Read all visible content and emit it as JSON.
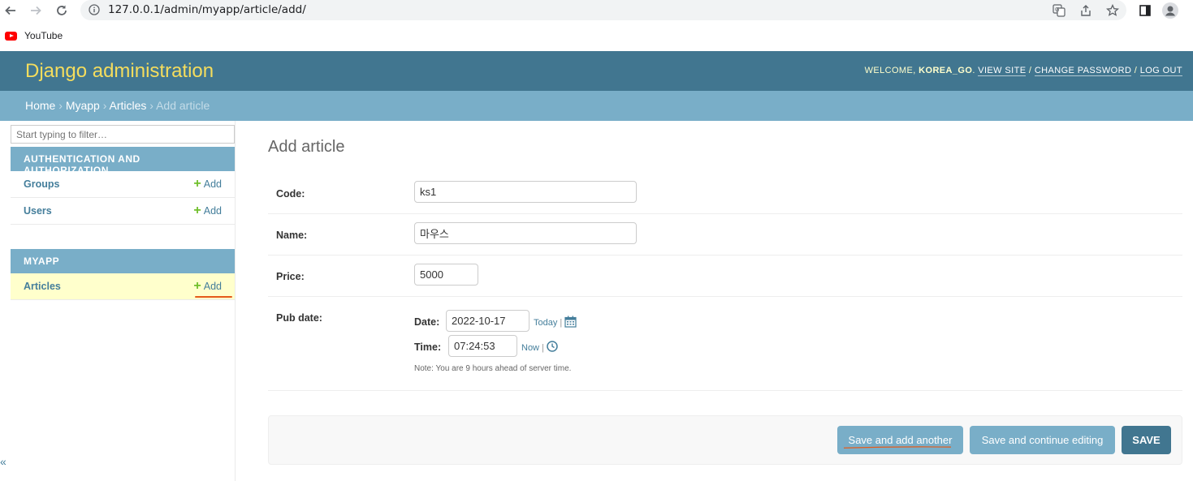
{
  "browser": {
    "url": "127.0.0.1/admin/myapp/article/add/",
    "bookmarks": [
      {
        "label": "YouTube"
      }
    ]
  },
  "header": {
    "site_title": "Django administration",
    "welcome_prefix": "WELCOME, ",
    "username": "KOREA_GO",
    "welcome_suffix": ". ",
    "view_site": "VIEW SITE",
    "sep1": " / ",
    "change_password": "CHANGE PASSWORD",
    "sep2": " / ",
    "logout": "LOG OUT"
  },
  "breadcrumbs": {
    "home": "Home",
    "sep": " › ",
    "app": "Myapp",
    "model": "Articles",
    "current": "Add article"
  },
  "sidebar": {
    "filter_placeholder": "Start typing to filter…",
    "modules": [
      {
        "caption": "AUTHENTICATION AND AUTHORIZATION",
        "models": [
          {
            "name": "Groups",
            "add_label": "Add"
          },
          {
            "name": "Users",
            "add_label": "Add"
          }
        ]
      },
      {
        "caption": "MYAPP",
        "models": [
          {
            "name": "Articles",
            "add_label": "Add",
            "current": true
          }
        ]
      }
    ],
    "collapse_glyph": "«"
  },
  "form": {
    "title": "Add article",
    "fields": {
      "code": {
        "label": "Code:",
        "value": "ks1"
      },
      "name": {
        "label": "Name:",
        "value": "마우스"
      },
      "price": {
        "label": "Price:",
        "value": "5000"
      },
      "pub_date": {
        "label": "Pub date:",
        "date_label": "Date:",
        "date_value": "2022-10-17",
        "today_label": "Today",
        "time_label": "Time:",
        "time_value": "07:24:53",
        "now_label": "Now",
        "sep": "|",
        "note": "Note: You are 9 hours ahead of server time."
      }
    },
    "buttons": {
      "save_add_another": "Save and add another",
      "save_continue": "Save and continue editing",
      "save": "SAVE"
    }
  },
  "colors": {
    "header_bg": "#417690",
    "breadcrumb_bg": "#79aec8",
    "title_yellow": "#f5dd5d",
    "link_blue": "#447e9b",
    "add_green": "#70bf2b",
    "annotation_red": "#e55b1a",
    "current_row_bg": "#ffffcc"
  }
}
